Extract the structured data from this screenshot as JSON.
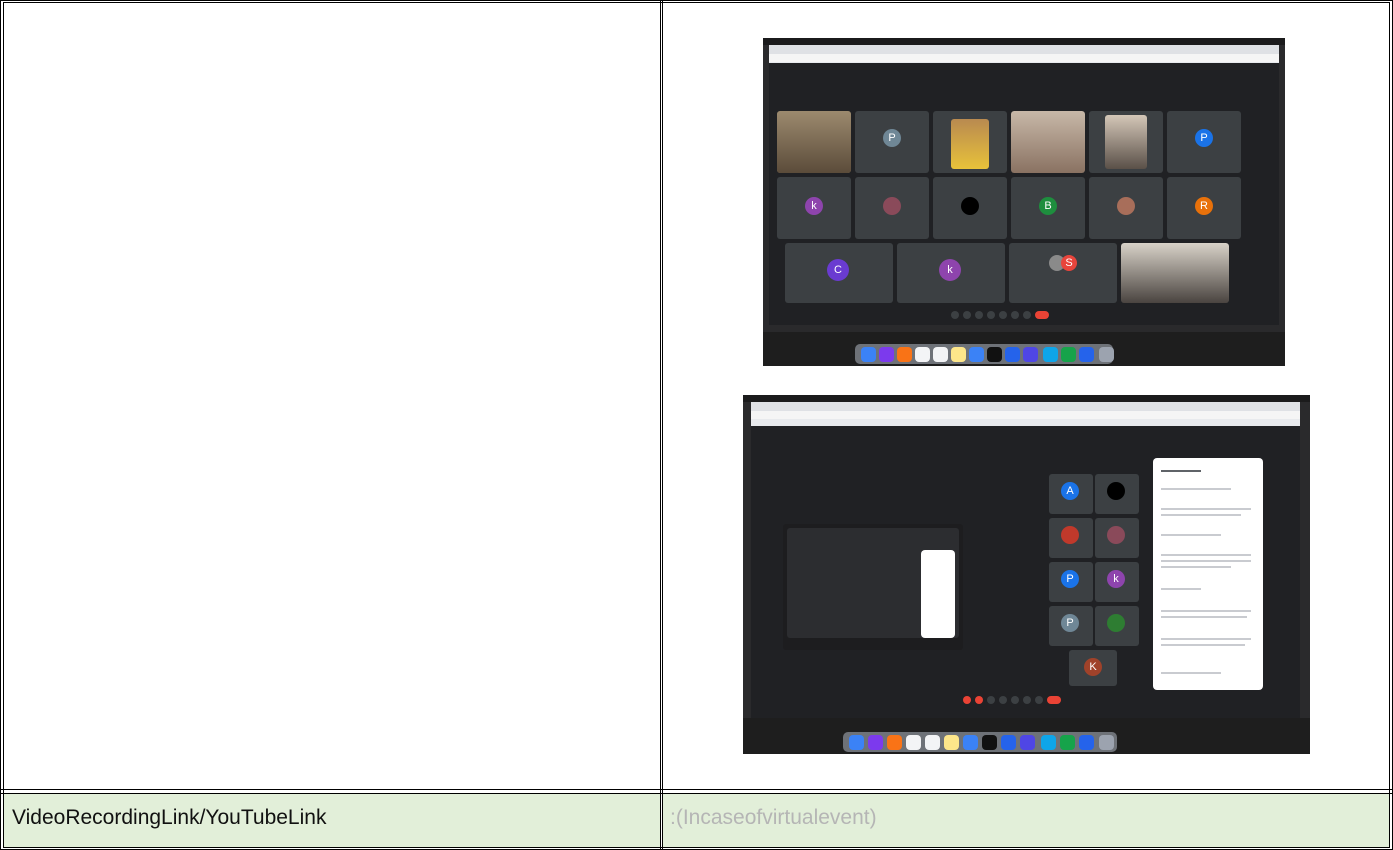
{
  "table": {
    "row2": {
      "label": "VideoRecordingLink/YouTubeLink",
      "value": ":(Incaseofvirtualevent)"
    }
  },
  "screenshots": [
    {
      "alt": "meeting-grid-screenshot"
    },
    {
      "alt": "meeting-with-chat-screenshot"
    }
  ],
  "colors": {
    "row_bg": "#e2efd9",
    "placeholder_text": "#b5b5b5",
    "meet_bg": "#202124",
    "tile_bg": "#3c4043"
  }
}
